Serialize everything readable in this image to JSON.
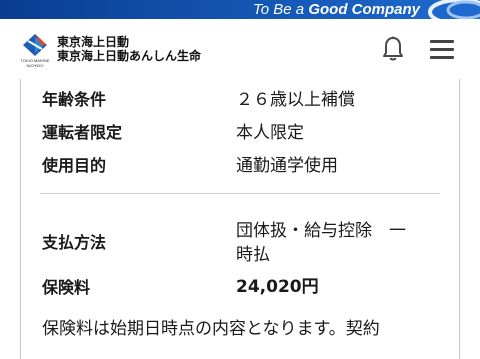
{
  "brand": {
    "slogan_prefix": "To Be a ",
    "slogan_emphasis": "Good Company",
    "logo_caption_line1": "TOKIO MARINE",
    "logo_caption_line2": "NICHIDO",
    "company_name_1": "東京海上日動",
    "company_name_2": "東京海上日動あんしん生命",
    "accent_color": "#0a3d91"
  },
  "header": {
    "notification_icon": "bell-icon",
    "menu_icon": "hamburger-menu-icon"
  },
  "details": {
    "age_condition": {
      "label": "年齢条件",
      "value": "２６歳以上補償"
    },
    "driver_limit": {
      "label": "運転者限定",
      "value": "本人限定"
    },
    "usage_purpose": {
      "label": "使用目的",
      "value": "通勤通学使用"
    },
    "payment_method": {
      "label": "支払方法",
      "value_line1": "団体扱・給与控除　一",
      "value_line2": "時払"
    },
    "premium": {
      "label": "保険料",
      "value": "24,020円"
    }
  },
  "note": "保険料は始期日時点の内容となります。契約"
}
